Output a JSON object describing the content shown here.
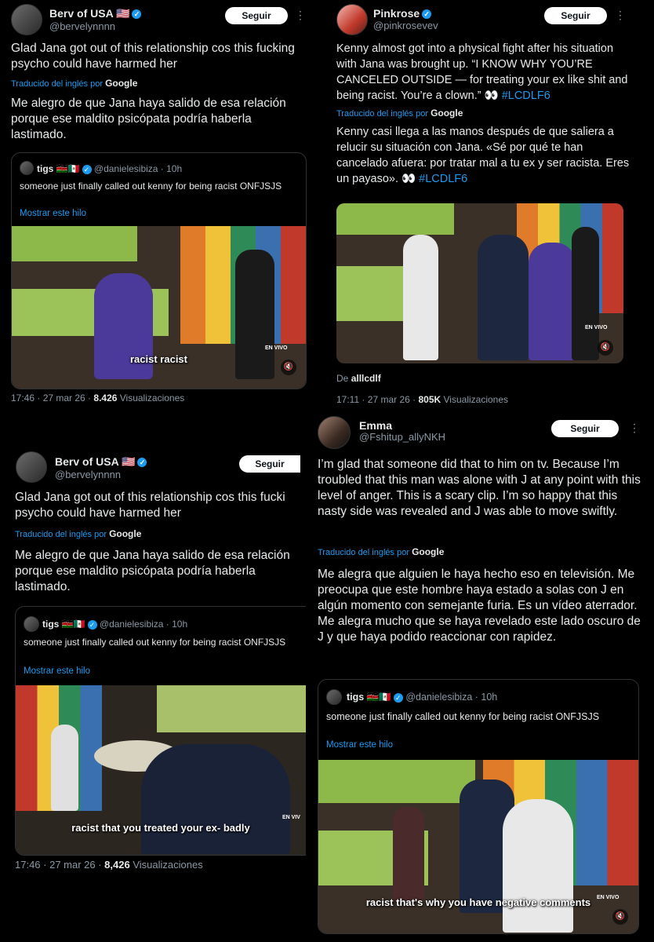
{
  "panel1": {
    "name": "Berv of USA 🇺🇸",
    "handle": "@bervelynnnn",
    "follow": "Seguir",
    "more": "⋮",
    "text": "Glad Jana got out of this relationship cos this fucking psycho could have harmed her",
    "translated_by": "Traducido del inglés por",
    "google": "Google",
    "translation": "Me alegro de que Jana haya salido de esa relación porque ese maldito psicópata podría haberla lastimado.",
    "quote": {
      "name": "tigs 🇰🇪🇲🇽",
      "handle": "@danielesibiza · 10h",
      "text": "someone just finally called out kenny for being racist ONFJSJS",
      "link": "Mostrar este hilo",
      "caption": "racist racist",
      "live": "EN VIVO"
    },
    "time": "17:46 · 27 mar 26 · ",
    "views": "8.426",
    "views_label": " Visualizaciones"
  },
  "panel2": {
    "name": "Pinkrose",
    "handle": "@pinkrosevev",
    "follow": "Seguir",
    "more": "⋮",
    "text": "Kenny almost got into a physical fight after his situation with Jana was brought up. “I KNOW WHY YOU’RE CANCELED OUTSIDE — for treating your ex like shit and being racist. You’re a clown.” 👀",
    "hashtag": "#LCDLF6",
    "translated_by": "Traducido del inglés por",
    "google": "Google",
    "translation": "Kenny casi llega a las manos después de que saliera a relucir su situación con Jana. «Sé por qué te han cancelado afuera: por tratar mal a tu ex y ser racista. Eres un payaso». 👀",
    "hashtag_es": "#LCDLF6",
    "live": "EN VIVO",
    "source_label": "De ",
    "source": "alllcdlf",
    "time": "17:11 · 27 mar 26 · ",
    "views": "805K",
    "views_label": " Visualizaciones"
  },
  "panel3": {
    "name": "Berv of USA 🇺🇸",
    "handle": "@bervelynnnn",
    "follow": "Seguir",
    "text": "Glad Jana got out of this relationship cos this fucki psycho could have harmed her",
    "translated_by": "Traducido del inglés por",
    "google": "Google",
    "translation": "Me alegro de que Jana haya salido de esa relación porque ese maldito psicópata podría haberla lastimado.",
    "quote": {
      "name": "tigs 🇰🇪🇲🇽",
      "handle": "@danielesibiza · 10h",
      "text": "someone just finally called out kenny for being racist ONFJSJS",
      "link": "Mostrar este hilo",
      "caption": "racist that you treated your ex- badly",
      "live": "EN VIV"
    },
    "time": "17:46 · 27 mar 26 · ",
    "views": "8,426",
    "views_label": " Visualizaciones"
  },
  "panel4": {
    "name": "Emma",
    "handle": "@Fshitup_allyNKH",
    "follow": "Seguir",
    "more": "⋮",
    "text": "I’m glad that someone did that to him on tv. Because I’m troubled that this man was alone with J at any point with this level of anger. This is a scary clip. I’m so happy that this nasty side was revealed and J was able to move swiftly.",
    "translated_by": "Traducido del inglés por",
    "google": "Google",
    "translation": "Me alegra que alguien le haya hecho eso en televisión. Me preocupa que este hombre haya estado a solas con J en algún momento con semejante furia. Es un vídeo aterrador. Me alegra mucho que se haya revelado este lado oscuro de J y que haya podido reaccionar con rapidez.",
    "quote": {
      "name": "tigs 🇰🇪🇲🇽",
      "handle": "@danielesibiza · 10h",
      "text": "someone just finally called out kenny for being racist ONFJSJS",
      "link": "Mostrar este hilo",
      "caption": "racist that's why you have negative comments",
      "live": "EN VIVO"
    }
  },
  "colors": {
    "link": "#1d9bf0",
    "muted": "#8b98a5",
    "text": "#e7e9ea",
    "bg": "#000000"
  },
  "icons": {
    "verified": "verified-badge-icon",
    "mute": "speaker-mute-icon",
    "more": "more-dots-icon"
  }
}
